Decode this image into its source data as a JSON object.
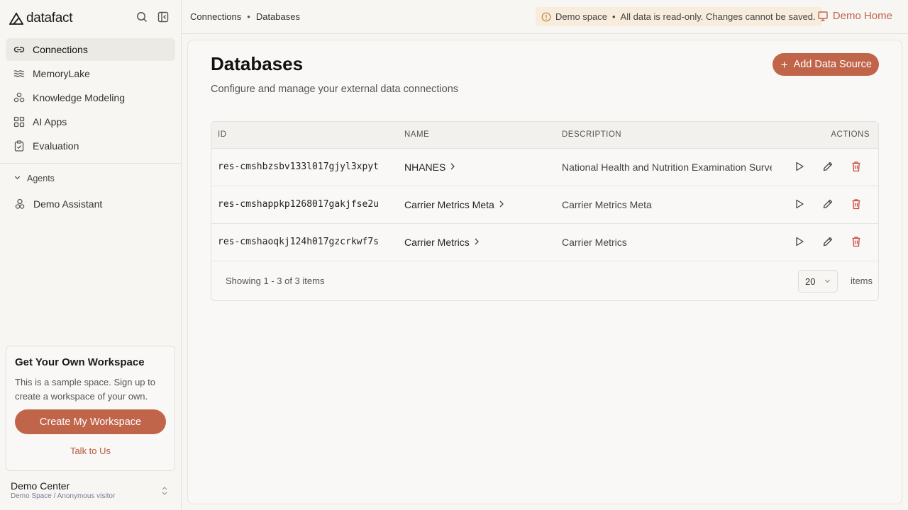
{
  "brand": {
    "name": "datafact"
  },
  "sidebar": {
    "items": [
      {
        "label": "Connections",
        "icon": "link-icon",
        "active": true
      },
      {
        "label": "MemoryLake",
        "icon": "waves-icon"
      },
      {
        "label": "Knowledge Modeling",
        "icon": "network-icon"
      },
      {
        "label": "AI Apps",
        "icon": "grid-icon"
      },
      {
        "label": "Evaluation",
        "icon": "clipboard-check-icon"
      }
    ],
    "agents_label": "Agents",
    "agent": {
      "label": "Demo Assistant",
      "icon": "bot-icon"
    },
    "promo": {
      "title": "Get Your Own Workspace",
      "text": "This is a sample space. Sign up to create a workspace of your own.",
      "button": "Create My Workspace",
      "link": "Talk to Us"
    },
    "account": {
      "name": "Demo Center",
      "sub": "Demo Space / Anonymous visitor"
    }
  },
  "topbar": {
    "breadcrumb": [
      "Connections",
      "Databases"
    ],
    "banner": {
      "label": "Demo space",
      "message": "All data is read-only. Changes cannot be saved."
    },
    "demo_home": "Demo Home"
  },
  "page": {
    "title": "Databases",
    "subtitle": "Configure and manage your external data connections",
    "add_button": "Add Data Source"
  },
  "table": {
    "columns": [
      "ID",
      "NAME",
      "DESCRIPTION",
      "ACTIONS"
    ],
    "rows": [
      {
        "id": "res-cmshbzsbv133l017gjyl3xpyt",
        "name": "NHANES",
        "description": "National Health and Nutrition Examination Survey"
      },
      {
        "id": "res-cmshappkp1268017gakjfse2u",
        "name": "Carrier Metrics Meta",
        "description": "Carrier Metrics Meta"
      },
      {
        "id": "res-cmshaoqkj124h017gzcrkwf7s",
        "name": "Carrier Metrics",
        "description": "Carrier Metrics"
      }
    ],
    "footer": {
      "showing": "Showing 1 - 3 of 3 items",
      "page_size": "20",
      "items_label": "items"
    }
  },
  "colors": {
    "accent": "#c0654a",
    "delete": "#c94a3a",
    "banner_bg": "#f8ecdd"
  }
}
